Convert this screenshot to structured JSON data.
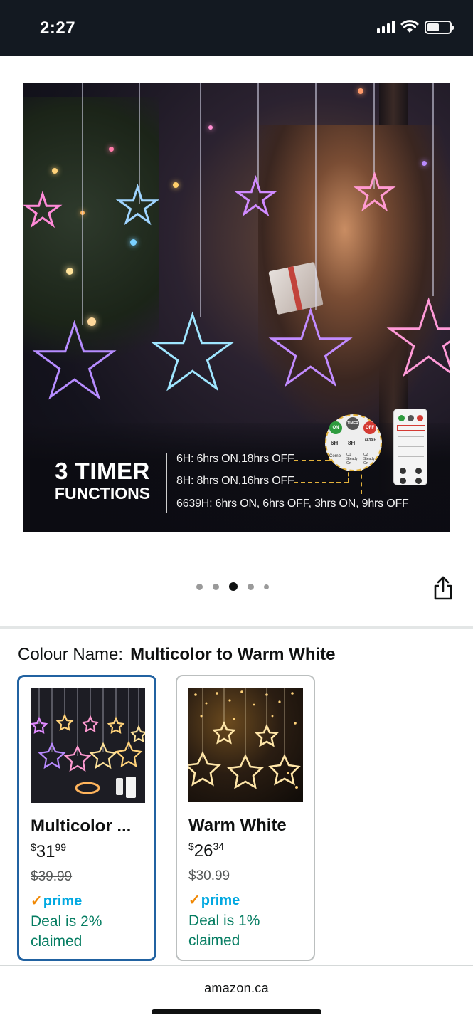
{
  "status_bar": {
    "time": "2:27",
    "icons": [
      "cellular-signal-icon",
      "wifi-icon",
      "battery-icon"
    ]
  },
  "hero": {
    "timer_title_big": "3 TIMER",
    "timer_title_small": "FUNCTIONS",
    "timer_lines": [
      "6H: 6hrs ON,18hrs OFF",
      "8H: 8hrs ON,16hrs OFF",
      "6639H: 6hrs ON, 6hrs OFF, 3hrs ON, 9hrs OFF"
    ],
    "remote_buttons": {
      "on": "ON",
      "timer": "TIMER",
      "off": "OFF",
      "b6h": "6H",
      "b8h": "8H",
      "b6639": "6639 H",
      "comb": "Comb",
      "c1": "C1 Steady On",
      "c2": "C2 Steady On"
    }
  },
  "pager": {
    "count": 5,
    "active_index": 2
  },
  "colour": {
    "label": "Colour Name:",
    "value": "Multicolor to Warm White"
  },
  "swatches": [
    {
      "name": "Multicolor ...",
      "price_symbol": "$",
      "price_whole": "31",
      "price_cents": "99",
      "list_price": "$39.99",
      "prime_label": "prime",
      "deal": "Deal is 2% claimed",
      "selected": true
    },
    {
      "name": "Warm White",
      "price_symbol": "$",
      "price_whole": "26",
      "price_cents": "34",
      "list_price": "$30.99",
      "prime_label": "prime",
      "deal": "Deal is 1% claimed",
      "selected": false
    }
  ],
  "footer": {
    "domain": "amazon.ca"
  },
  "colors": {
    "status_bar_bg": "#131921",
    "selected_border": "#2162a1",
    "prime_blue": "#00a8e1",
    "prime_check": "#f08804",
    "deal_green": "#067d62"
  }
}
